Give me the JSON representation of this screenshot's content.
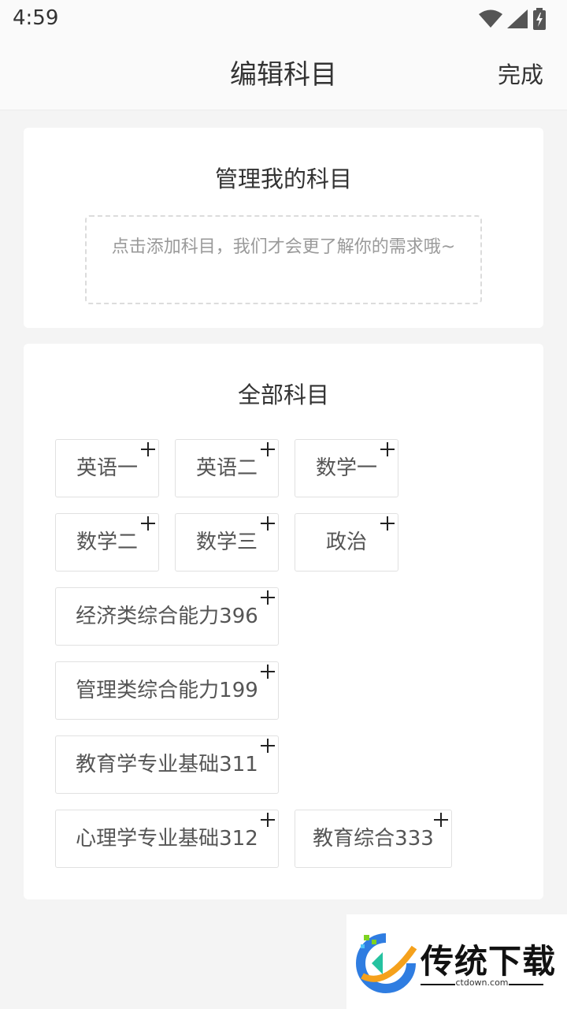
{
  "status_bar": {
    "time": "4:59"
  },
  "header": {
    "title": "编辑科目",
    "done_label": "完成"
  },
  "my_subjects": {
    "title": "管理我的科目",
    "empty_hint": "点击添加科目，我们才会更了解你的需求哦~"
  },
  "all_subjects": {
    "title": "全部科目",
    "items": [
      {
        "label": "英语一"
      },
      {
        "label": "英语二"
      },
      {
        "label": "数学一"
      },
      {
        "label": "数学二"
      },
      {
        "label": "数学三"
      },
      {
        "label": "政治"
      },
      {
        "label": "经济类综合能力396"
      },
      {
        "label": "管理类综合能力199"
      },
      {
        "label": "教育学专业基础311"
      },
      {
        "label": "心理学专业基础312"
      },
      {
        "label": "教育综合333"
      }
    ]
  },
  "watermark": {
    "brand": "传统下载",
    "domain": "ctdown.com"
  },
  "colors": {
    "background": "#f4f4f4",
    "card": "#ffffff",
    "text": "#333333",
    "hint": "#9a9a9a",
    "tag_border": "#e1e1e1"
  }
}
